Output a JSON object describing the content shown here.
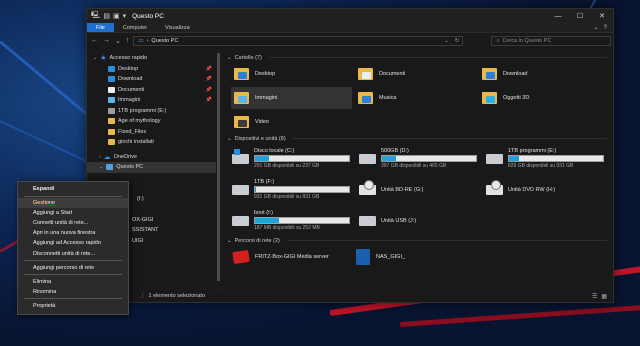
{
  "window": {
    "title": "Questo PC",
    "controls": [
      "—",
      "☐",
      "✕"
    ]
  },
  "ribbon": {
    "tabs": [
      "File",
      "Computer",
      "Visualizza"
    ],
    "active_tab": "File",
    "collapse_icon": "chevron-down-icon",
    "help_icon": "?"
  },
  "address": {
    "path": "Questo PC",
    "search_placeholder": "Cerca in Questo PC"
  },
  "sidebar": {
    "items": [
      {
        "label": "Accesso rapido",
        "icon": "star-icon"
      },
      {
        "label": "Desktop",
        "icon": "desktop-icon",
        "pinned": true
      },
      {
        "label": "Download",
        "icon": "download-icon",
        "pinned": true
      },
      {
        "label": "Documenti",
        "icon": "documents-icon",
        "pinned": true
      },
      {
        "label": "Immagini",
        "icon": "pictures-icon",
        "pinned": true
      },
      {
        "label": "1TB programmi (E:)",
        "icon": "drive-icon"
      },
      {
        "label": "Age of mythology",
        "icon": "folder-icon"
      },
      {
        "label": "Fixed_Files",
        "icon": "folder-icon"
      },
      {
        "label": "giochi installati",
        "icon": "folder-icon"
      },
      {
        "label": "OneDrive",
        "icon": "cloud-icon"
      },
      {
        "label": "Questo PC",
        "icon": "pc-icon"
      },
      {
        "label": "",
        "icon": "folder-icon"
      },
      {
        "label": "",
        "icon": "folder-icon"
      },
      {
        "label": "(I:)",
        "icon": "drive-icon"
      },
      {
        "label": "",
        "icon": "drive-icon"
      },
      {
        "label": "OX-GIGI",
        "icon": "network-icon"
      },
      {
        "label": "SSISTANT",
        "icon": "network-icon"
      },
      {
        "label": "UIGI",
        "icon": "network-icon"
      },
      {
        "label": "",
        "icon": "network-icon"
      }
    ]
  },
  "folders": {
    "header": "Cartelle (7)",
    "items": [
      {
        "label": "Desktop",
        "kind": "desk"
      },
      {
        "label": "Documenti",
        "kind": "doc"
      },
      {
        "label": "Download",
        "kind": "dl"
      },
      {
        "label": "Immagini",
        "kind": "img",
        "selected": true
      },
      {
        "label": "Musica",
        "kind": "mus"
      },
      {
        "label": "Oggetti 3D",
        "kind": "obj"
      },
      {
        "label": "Video",
        "kind": "vid"
      }
    ]
  },
  "drives": {
    "header": "Dispositivi e unità (8)",
    "items": [
      {
        "name": "Disco locale (C:)",
        "free": "201 GB disponibili su 237 GB",
        "used_pct": 15,
        "icon": "windows-drive-icon"
      },
      {
        "name": "500GB (D:)",
        "free": "397 GB disponibili su 465 GB",
        "used_pct": 15,
        "icon": "hard-drive-icon"
      },
      {
        "name": "1TB programmi (E:)",
        "free": "829 GB disponibili su 931 GB",
        "used_pct": 11,
        "icon": "hard-drive-icon"
      },
      {
        "name": "1TB (F:)",
        "free": "931 GB disponibili su 931 GB",
        "used_pct": 1,
        "icon": "hard-drive-icon"
      },
      {
        "name": "Unità BD-RE (G:)",
        "free": "",
        "used_pct": null,
        "icon": "bd-drive-icon"
      },
      {
        "name": "Unità DVD RW (H:)",
        "free": "",
        "used_pct": null,
        "icon": "dvd-drive-icon"
      },
      {
        "name": "boot (I:)",
        "free": "187 MB disponibili su 252 MB",
        "used_pct": 26,
        "icon": "hard-drive-icon"
      },
      {
        "name": "Unità USB (J:)",
        "free": "",
        "used_pct": null,
        "icon": "usb-drive-icon"
      }
    ]
  },
  "network": {
    "header": "Percorsi di rete (2)",
    "items": [
      {
        "label": "FRITZ-Box-GIGI Media server",
        "icon": "fritz-icon"
      },
      {
        "label": "NAS_GIGI_",
        "icon": "nas-icon"
      }
    ]
  },
  "status": {
    "count": "1 elemento selezionato"
  },
  "context_menu": {
    "groups": [
      [
        "Espandi"
      ],
      [
        "Gestione",
        "Aggiungi a Start",
        "Connetti unità di rete...",
        "Apri in una nuova finestra",
        "Aggiungi ad Accesso rapido",
        "Disconnetti unità di rete..."
      ],
      [
        "Aggiungi percorso di rete"
      ],
      [
        "Elimina",
        "Rinomina"
      ],
      [
        "Proprietà"
      ]
    ],
    "highlighted": "Gestione"
  },
  "colors": {
    "accent": "#1f6fd1",
    "bar_fill": "#26a0da",
    "background": "#191919"
  }
}
